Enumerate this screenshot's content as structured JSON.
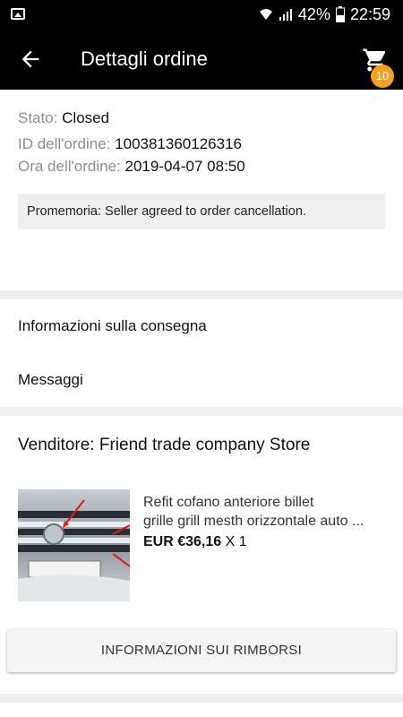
{
  "status_bar": {
    "battery": "42%",
    "time": "22:59"
  },
  "app_bar": {
    "title": "Dettagli ordine",
    "cart_count": "10"
  },
  "order": {
    "status_label": "Stato:",
    "status_value": "Closed",
    "id_label": "ID dell'ordine:",
    "id_value": "100381360126316",
    "time_label": "Ora dell'ordine:",
    "time_value": "2019-04-07 08:50",
    "reminder": "Promemoria: Seller agreed to order cancellation."
  },
  "links": {
    "delivery": "Informazioni sulla consegna",
    "messages": "Messaggi"
  },
  "seller": {
    "label": "Venditore: Friend trade company Store"
  },
  "product": {
    "title_line1": "Refit cofano anteriore billet",
    "title_line2": "grille grill mesth orizzontale auto ...",
    "price": "EUR €36,16",
    "quantity": "X 1"
  },
  "refund_button": "INFORMAZIONI SUI RIMBORSI",
  "colors": {
    "bar": "#000000",
    "badge": "#f7a01d",
    "background": "#eeeeee"
  }
}
